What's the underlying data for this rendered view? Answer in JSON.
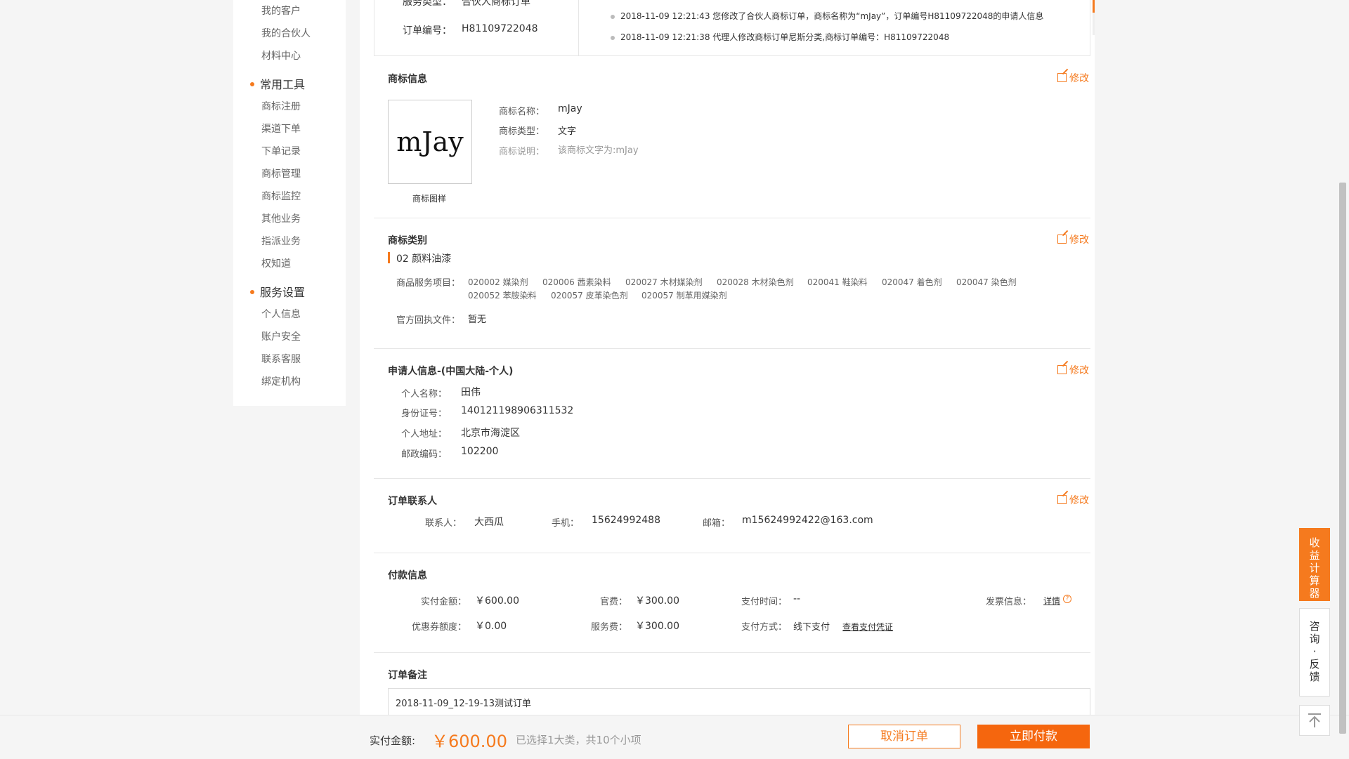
{
  "sidebar": {
    "items_top": [
      "我的客户",
      "我的合伙人",
      "材料中心"
    ],
    "section_tools": "常用工具",
    "tools": [
      "商标注册",
      "渠道下单",
      "下单记录",
      "商标管理",
      "商标监控",
      "其他业务",
      "指派业务",
      "权知道"
    ],
    "section_settings": "服务设置",
    "settings": [
      "个人信息",
      "账户安全",
      "联系客服",
      "绑定机构"
    ]
  },
  "order_card": {
    "service_type_label": "服务类型：",
    "service_type_value": "合伙人商标订单",
    "order_no_label": "订单编号：",
    "order_no_value": "H81109722048",
    "logs": [
      "2018-11-09 12:21:43 您修改了合伙人商标订单，商标名称为“mJay”，订单编号H81109722048的申请人信息",
      "2018-11-09 12:21:38 代理人修改商标订单尼斯分类,商标订单编号：H81109722048"
    ]
  },
  "trademark_info": {
    "title": "商标信息",
    "edit": "修改",
    "logo_text": "mJay",
    "logo_caption": "商标图样",
    "name_label": "商标名称：",
    "name_value": "mJay",
    "type_label": "商标类型：",
    "type_value": "文字",
    "desc_label": "商标说明：",
    "desc_value": "该商标文字为:mJay"
  },
  "trademark_class": {
    "title": "商标类别",
    "edit": "修改",
    "class_name": "02 颜料油漆",
    "items_label": "商品服务项目：",
    "items": [
      "020002 媒染剂",
      "020006 茜素染料",
      "020027 木材媒染剂",
      "020028 木材染色剂",
      "020041 鞋染料",
      "020047 着色剂",
      "020047 染色剂",
      "020052 苯胺染料",
      "020057 皮革染色剂",
      "020057 制革用媒染剂"
    ],
    "docs_label": "官方回执文件：",
    "docs_value": "暂无"
  },
  "applicant": {
    "title": "申请人信息-(中国大陆-个人)",
    "edit": "修改",
    "name_label": "个人名称：",
    "name_value": "田伟",
    "id_label": "身份证号：",
    "id_value": "140121198906311532",
    "addr_label": "个人地址：",
    "addr_value": "北京市海淀区",
    "zip_label": "邮政编码：",
    "zip_value": "102200"
  },
  "contact": {
    "title": "订单联系人",
    "edit": "修改",
    "person_label": "联系人：",
    "person_value": "大西瓜",
    "phone_label": "手机：",
    "phone_value": "15624992488",
    "email_label": "邮箱：",
    "email_value": "m15624992422@163.com"
  },
  "payment": {
    "title": "付款信息",
    "paid_label": "实付金额：",
    "paid_value": "￥600.00",
    "official_label": "官费：",
    "official_value": "￥300.00",
    "paytime_label": "支付时间：",
    "paytime_value": "--",
    "invoice_label": "发票信息：",
    "invoice_value": "详情",
    "coupon_label": "优惠券额度：",
    "coupon_value": "￥0.00",
    "service_label": "服务费：",
    "service_value": "￥300.00",
    "method_label": "支付方式：",
    "method_value": "线下支付",
    "voucher_link": "查看支付凭证"
  },
  "remark": {
    "title": "订单备注",
    "value": "2018-11-09_12-19-13测试订单"
  },
  "bottom": {
    "paid_label": "实付金额:",
    "paid_value": "￥600.00",
    "selection_text": "已选择1大类，共10个小项",
    "cancel": "取消订单",
    "pay": "立即付款"
  },
  "floating": {
    "calc": [
      "收",
      "益",
      "计",
      "算",
      "器"
    ],
    "consult": [
      "咨",
      "询",
      "·",
      "反",
      "馈"
    ]
  },
  "colors": {
    "accent": "#f57a1e",
    "pay_button": "#f5660e"
  }
}
